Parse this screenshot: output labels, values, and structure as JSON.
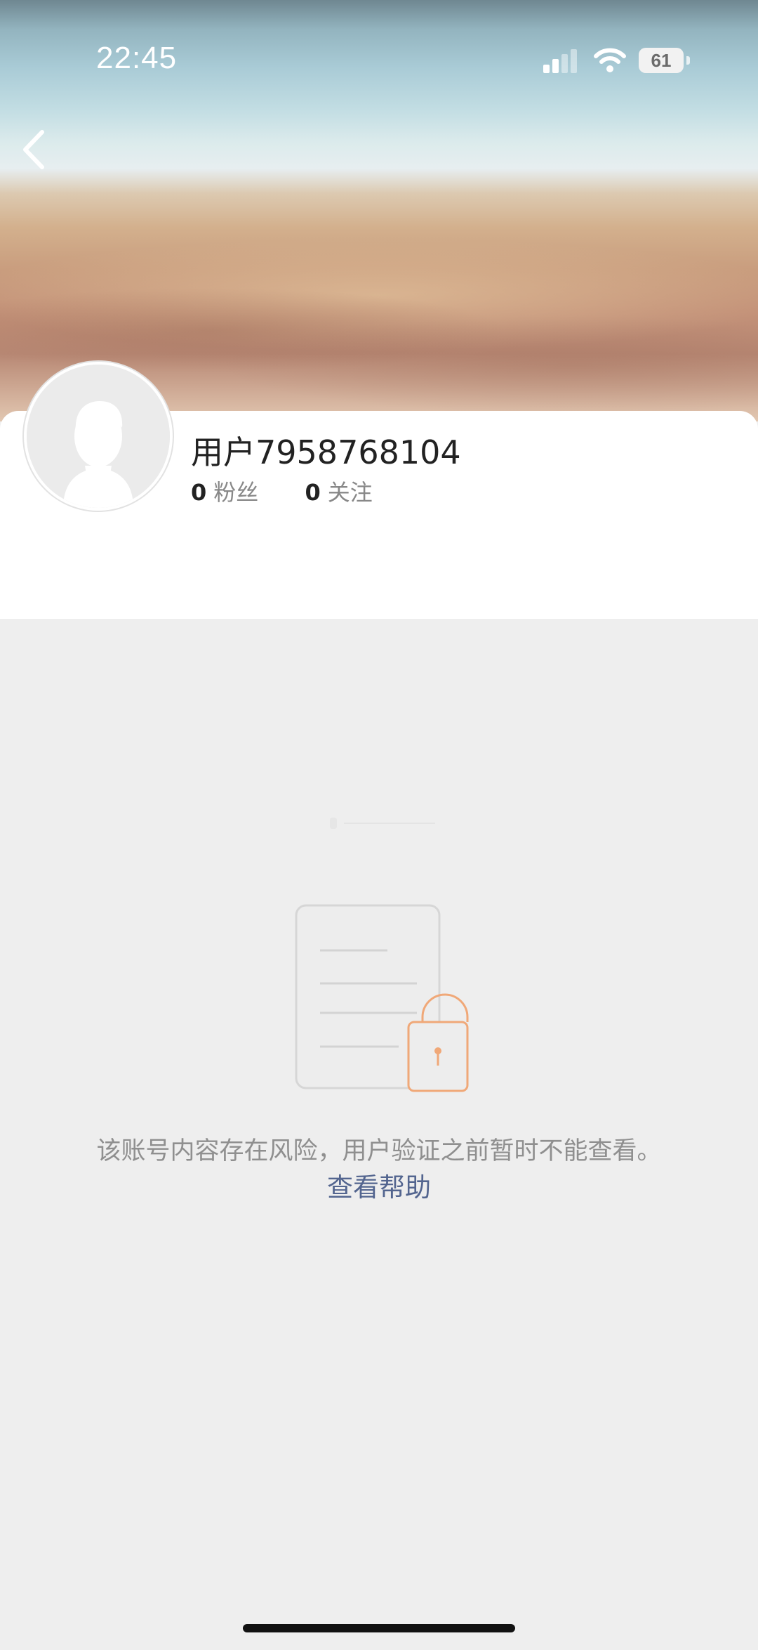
{
  "status_bar": {
    "time": "22:45",
    "battery_level": "61",
    "icons": [
      "cellular-signal-icon",
      "wifi-icon",
      "battery-icon"
    ]
  },
  "nav": {
    "back_icon": "chevron-left-icon"
  },
  "profile": {
    "username": "用户7958768104",
    "followers_count": "0",
    "followers_label": "粉丝",
    "following_count": "0",
    "following_label": "关注",
    "avatar_icon": "default-avatar-icon"
  },
  "content": {
    "illustration_icon": "locked-document-icon",
    "risk_message": "该账号内容存在风险，用户验证之前暂时不能查看。",
    "help_link": "查看帮助"
  },
  "colors": {
    "background": "#eeeeee",
    "card": "#ffffff",
    "link": "#53658f",
    "lock_accent": "#f0a878"
  }
}
